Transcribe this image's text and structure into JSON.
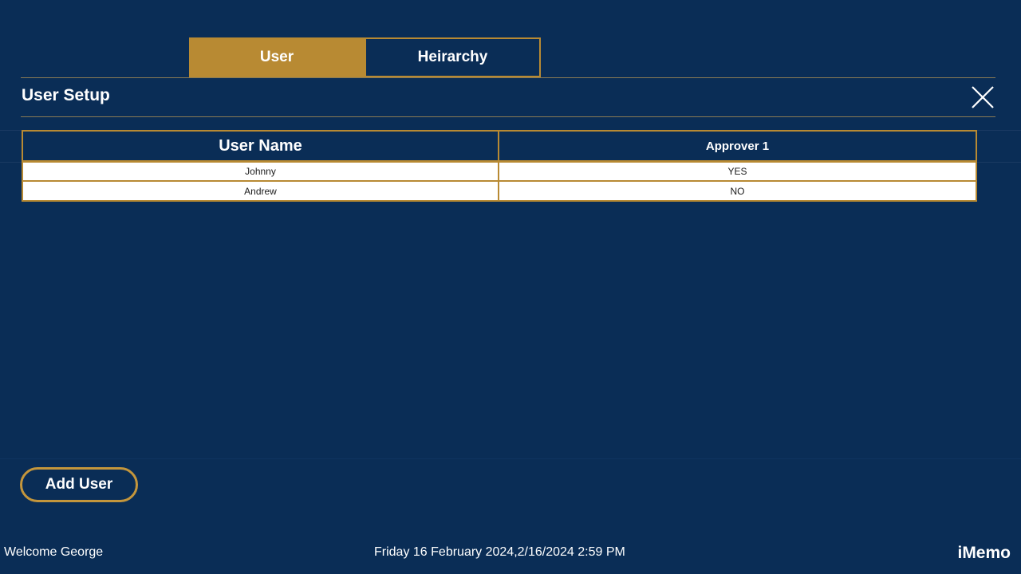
{
  "tabs": [
    {
      "label": "User",
      "active": true
    },
    {
      "label": "Heirarchy",
      "active": false
    }
  ],
  "panel": {
    "title": "User Setup"
  },
  "table": {
    "headers": [
      "User Name",
      "Approver 1"
    ],
    "rows": [
      [
        "Johnny",
        "YES"
      ],
      [
        "Andrew",
        "NO"
      ]
    ]
  },
  "actions": {
    "add_user_label": "Add User"
  },
  "footer": {
    "welcome": "Welcome George",
    "datetime": "Friday 16 February 2024,2/16/2024 2:59 PM",
    "brand": "iMemo"
  },
  "colors": {
    "background": "#0a2d56",
    "accent": "#b88a33",
    "row_background": "#ffffff"
  },
  "icons": {
    "close": "close-icon"
  }
}
